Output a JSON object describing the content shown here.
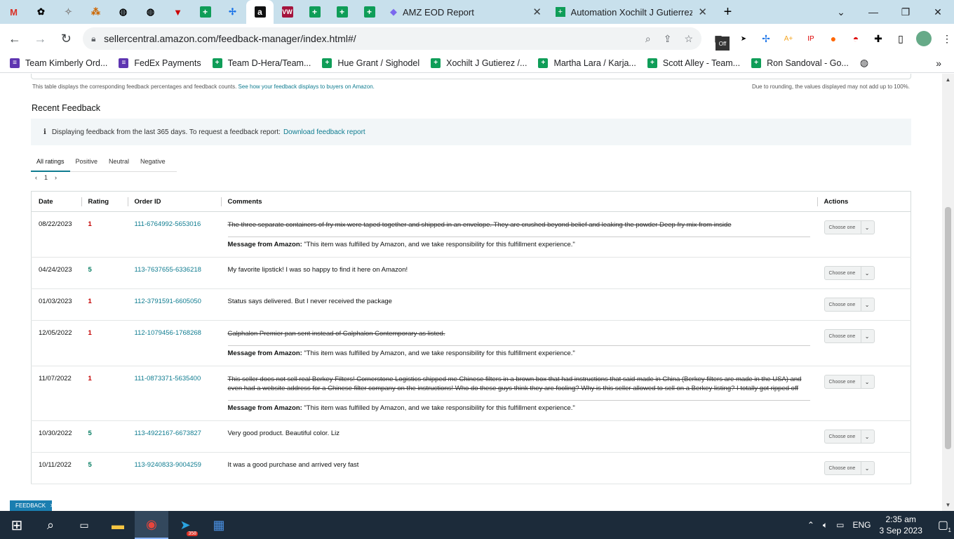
{
  "browser": {
    "tabs": [
      {
        "label": "AMZ EOD Report",
        "icon": "clickup-icon"
      },
      {
        "label": "Automation Xochilt J Gutierrez (C",
        "icon": "sheets-icon"
      }
    ],
    "pinned_tabs": [
      "gmail-icon",
      "openai-icon",
      "app-icon",
      "app-icon",
      "globe-icon",
      "globe-icon",
      "shield-icon",
      "sheets-icon",
      "app-icon",
      "amazon-icon",
      "vw-icon",
      "sheets-icon",
      "sheets-icon",
      "sheets-icon"
    ],
    "url": "sellercentral.amazon.com/feedback-manager/index.html#/",
    "bookmarks": [
      {
        "label": "Team Kimberly Ord...",
        "color": "purple"
      },
      {
        "label": "FedEx Payments",
        "color": "purple"
      },
      {
        "label": "Team D-Hera/Team...",
        "color": "green"
      },
      {
        "label": "Hue Grant / Sighodel",
        "color": "green"
      },
      {
        "label": "Xochilt J Gutierez /...",
        "color": "green"
      },
      {
        "label": "Martha Lara / Karja...",
        "color": "green"
      },
      {
        "label": "Scott Alley - Team...",
        "color": "green"
      },
      {
        "label": "Ron Sandoval - Go...",
        "color": "green"
      }
    ],
    "ext_off_badge": "Off"
  },
  "page": {
    "display_note": "This table displays the corresponding feedback percentages and feedback counts.",
    "display_link": "See how your feedback displays to buyers on Amazon.",
    "rounding_note": "Due to rounding, the values displayed may not add up to 100%.",
    "section_title": "Recent Feedback",
    "info_text": "Displaying feedback from the last 365 days. To request a feedback report:",
    "info_link": "Download feedback report",
    "filter_tabs": [
      "All ratings",
      "Positive",
      "Neutral",
      "Negative"
    ],
    "page_number": "1",
    "columns": [
      "Date",
      "Rating",
      "Order ID",
      "Comments",
      "Actions"
    ],
    "select_placeholder": "Choose one",
    "amazon_msg_label": "Message from Amazon:",
    "amazon_msg_text": "\"This item was fulfilled by Amazon, and we take responsibility for this fulfillment experience.\"",
    "rows": [
      {
        "date": "08/22/2023",
        "rating": "1",
        "order": "111-6764992-5653016",
        "comment": "The three separate containers of fry mix were taped together and shipped in an envelope. They are crushed beyond belief and leaking the powder Deep fry mix from inside",
        "struck": true
      },
      {
        "date": "04/24/2023",
        "rating": "5",
        "order": "113-7637655-6336218",
        "comment": "My favorite lipstick! I was so happy to find it here on Amazon!",
        "struck": false
      },
      {
        "date": "01/03/2023",
        "rating": "1",
        "order": "112-3791591-6605050",
        "comment": "Status says delivered. But I never received the package",
        "struck": false
      },
      {
        "date": "12/05/2022",
        "rating": "1",
        "order": "112-1079456-1768268",
        "comment": "Calphalon Premier pan sent instead of Calphalon Contemporary as listed.",
        "struck": true
      },
      {
        "date": "11/07/2022",
        "rating": "1",
        "order": "111-0873371-5635400",
        "comment": "This seller does not sell real Berkey Filters! Cornerstone Logistics shipped me Chinese filters in a brown box that had instructions that said made in China (Berkey filters are made in the USA) and even had a website address for a Chinese filter company on the instructions! Who do these guys think they are fooling? Why is this seller allowed to sell on a Berkey listing? I totally got ripped off",
        "struck": true
      },
      {
        "date": "10/30/2022",
        "rating": "5",
        "order": "113-4922167-6673827",
        "comment": "Very good product. Beautiful color. Liz",
        "struck": false
      },
      {
        "date": "10/11/2022",
        "rating": "5",
        "order": "113-9240833-9004259",
        "comment": "It was a good purchase and arrived very fast",
        "struck": false
      }
    ],
    "feedback_pill": "FEEDBACK"
  },
  "taskbar": {
    "language": "ENG",
    "time": "2:35 am",
    "date": "3 Sep 2023",
    "telegram_badge": "358",
    "notification_count": "1"
  }
}
